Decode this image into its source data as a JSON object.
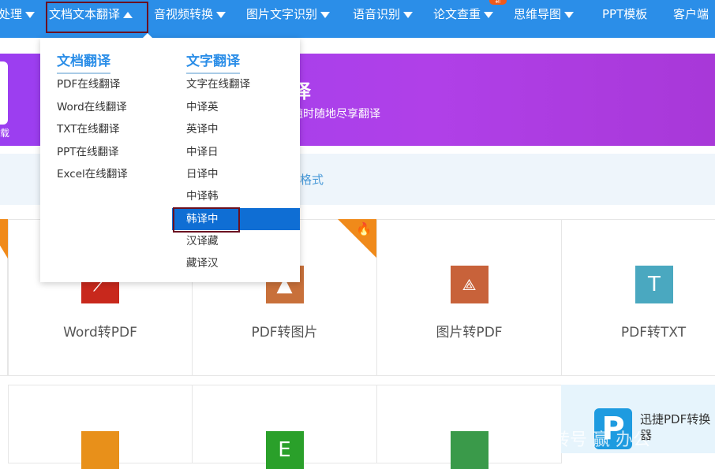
{
  "nav": {
    "items": [
      {
        "label": "处理",
        "caret": "down"
      },
      {
        "label": "文档文本翻译",
        "caret": "up"
      },
      {
        "label": "音视频转换",
        "caret": "down"
      },
      {
        "label": "图片文字识别",
        "caret": "down"
      },
      {
        "label": "语音识别",
        "caret": "down"
      },
      {
        "label": "论文查重",
        "caret": "down",
        "badge": "新"
      },
      {
        "label": "思维导图",
        "caret": "down"
      },
      {
        "label": "PPT模板"
      },
      {
        "label": "客户端"
      }
    ]
  },
  "banner": {
    "title": "译",
    "subtitle": "随时随地尽享翻译",
    "left_text": "载"
  },
  "band": {
    "text": "格式"
  },
  "dropdown": {
    "col1": {
      "heading": "文档翻译",
      "items": [
        "PDF在线翻译",
        "Word在线翻译",
        "TXT在线翻译",
        "PPT在线翻译",
        "Excel在线翻译"
      ]
    },
    "col2": {
      "heading": "文字翻译",
      "items": [
        "文字在线翻译",
        "中译英",
        "英译中",
        "中译日",
        "日译中",
        "中译韩",
        "韩译中",
        "汉译藏",
        "藏译汉"
      ],
      "highlighted": "韩译中"
    }
  },
  "cards": [
    {
      "label": "Word转PDF",
      "color": "#c8281c",
      "icon": "pdf-icon"
    },
    {
      "label": "PDF转图片",
      "color": "#c8703a",
      "icon": "image-icon"
    },
    {
      "label": "图片转PDF",
      "color": "#c8623a",
      "icon": "pdf-icon"
    },
    {
      "label": "PDF转TXT",
      "color": "#4aa8c0",
      "icon": "T"
    }
  ],
  "row2_colors": [
    "#e8901a",
    "#2aa02a",
    "#3a9a4a"
  ],
  "promo": {
    "text": "迅捷PDF转换器",
    "logo": "P"
  },
  "watermark": "转号 赢 办公"
}
